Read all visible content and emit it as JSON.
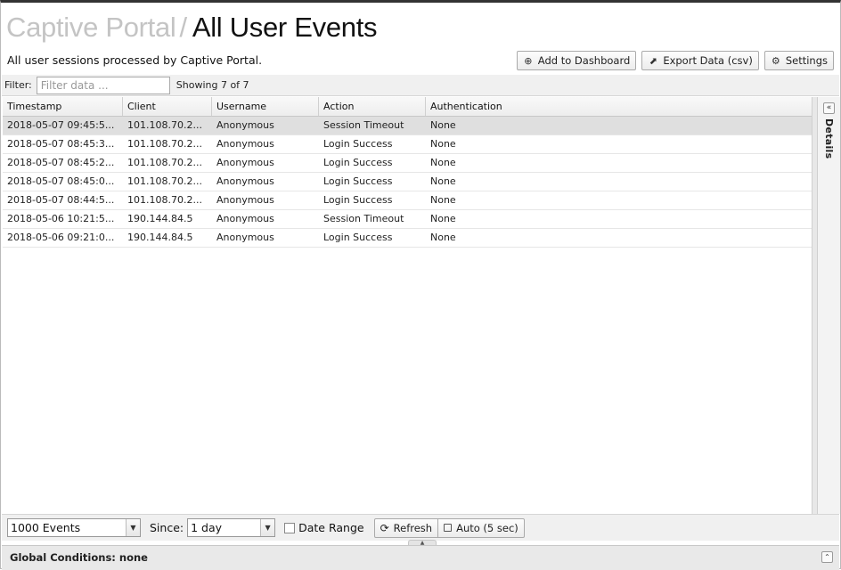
{
  "header": {
    "breadcrumb_parent": "Captive Portal",
    "separator": "/",
    "title": "All User Events",
    "description": "All user sessions processed by Captive Portal."
  },
  "toolbar": {
    "add_to_dashboard": "Add to Dashboard",
    "export_data": "Export Data (csv)",
    "settings": "Settings"
  },
  "filter": {
    "label": "Filter:",
    "placeholder": "Filter data ...",
    "value": "",
    "count_text": "Showing 7 of 7"
  },
  "table": {
    "columns": [
      "Timestamp",
      "Client",
      "Username",
      "Action",
      "Authentication"
    ],
    "rows": [
      [
        "2018-05-07 09:45:5...",
        "101.108.70.2...",
        "Anonymous",
        "Session Timeout",
        "None"
      ],
      [
        "2018-05-07 08:45:3...",
        "101.108.70.2...",
        "Anonymous",
        "Login Success",
        "None"
      ],
      [
        "2018-05-07 08:45:2...",
        "101.108.70.2...",
        "Anonymous",
        "Login Success",
        "None"
      ],
      [
        "2018-05-07 08:45:0...",
        "101.108.70.2...",
        "Anonymous",
        "Login Success",
        "None"
      ],
      [
        "2018-05-07 08:44:5...",
        "101.108.70.2...",
        "Anonymous",
        "Login Success",
        "None"
      ],
      [
        "2018-05-06 10:21:5...",
        "190.144.84.5",
        "Anonymous",
        "Session Timeout",
        "None"
      ],
      [
        "2018-05-06 09:21:0...",
        "190.144.84.5",
        "Anonymous",
        "Login Success",
        "None"
      ]
    ]
  },
  "details_panel": {
    "label": "Details"
  },
  "bottom": {
    "events_select": "1000 Events",
    "since_label": "Since:",
    "since_select": "1 day",
    "date_range_label": "Date Range",
    "refresh": "Refresh",
    "auto": "Auto (5 sec)"
  },
  "global_conditions": {
    "label": "Global Conditions: none"
  },
  "icons": {
    "add": "plus-circle-icon",
    "export": "external-link-icon",
    "settings": "gear-icon",
    "refresh": "refresh-icon"
  }
}
